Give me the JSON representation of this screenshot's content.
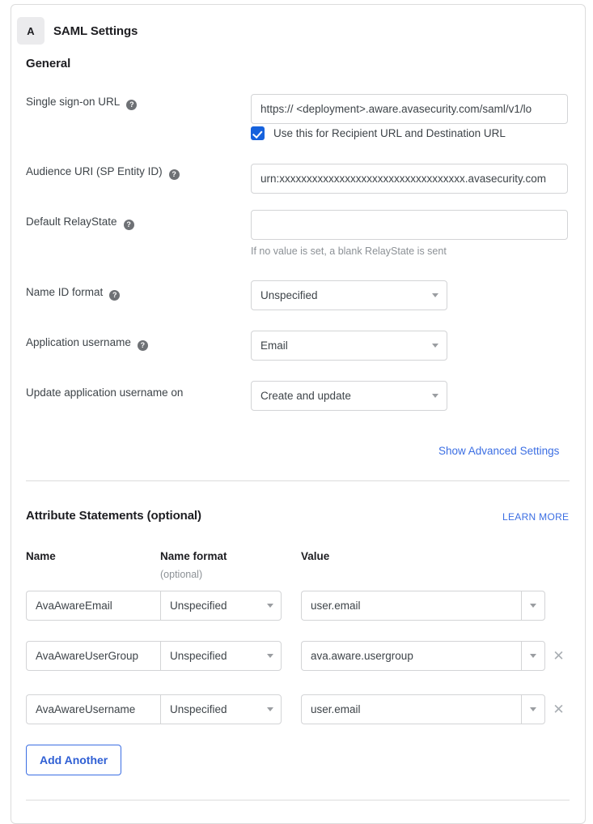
{
  "app": {
    "badge_letter": "A",
    "title": "SAML Settings"
  },
  "general": {
    "section_title": "General",
    "help_icon": "help-circle-icon",
    "sso_url": {
      "label": "Single sign-on URL",
      "value": "https:// <deployment>.aware.avasecurity.com/saml/v1/lo",
      "checkbox_label": "Use this for Recipient URL and Destination URL",
      "checkbox_checked": true
    },
    "audience_uri": {
      "label": "Audience URI (SP Entity ID)",
      "value": "urn:xxxxxxxxxxxxxxxxxxxxxxxxxxxxxxxxxx.avasecurity.com"
    },
    "default_relaystate": {
      "label": "Default RelayState",
      "value": "",
      "placeholder": "",
      "helper": "If no value is set, a blank RelayState is sent"
    },
    "name_id_format": {
      "label": "Name ID format",
      "value": "Unspecified"
    },
    "application_username": {
      "label": "Application username",
      "value": "Email"
    },
    "update_application_username_on": {
      "label": "Update application username on",
      "value": "Create and update"
    },
    "advanced_link": "Show Advanced Settings"
  },
  "attributes": {
    "section_title": "Attribute Statements (optional)",
    "learn_more": "LEARN MORE",
    "columns": {
      "name": "Name",
      "name_format": "Name format",
      "name_format_sub": "(optional)",
      "value": "Value"
    },
    "rows": [
      {
        "name": "AvaAwareEmail",
        "format": "Unspecified",
        "value": "user.email",
        "removable": false
      },
      {
        "name": "AvaAwareUserGroup",
        "format": "Unspecified",
        "value": "ava.aware.usergroup",
        "removable": true
      },
      {
        "name": "AvaAwareUsername",
        "format": "Unspecified",
        "value": "user.email",
        "removable": true
      }
    ],
    "add_another_label": "Add Another",
    "remove_icon": "close-x-icon"
  },
  "colors": {
    "accent_blue": "#3b6ee3",
    "checkbox_blue": "#1662dd",
    "border_gray": "#d3d4d6",
    "text_dark": "#1d1d21",
    "text_muted": "#8c9196"
  }
}
